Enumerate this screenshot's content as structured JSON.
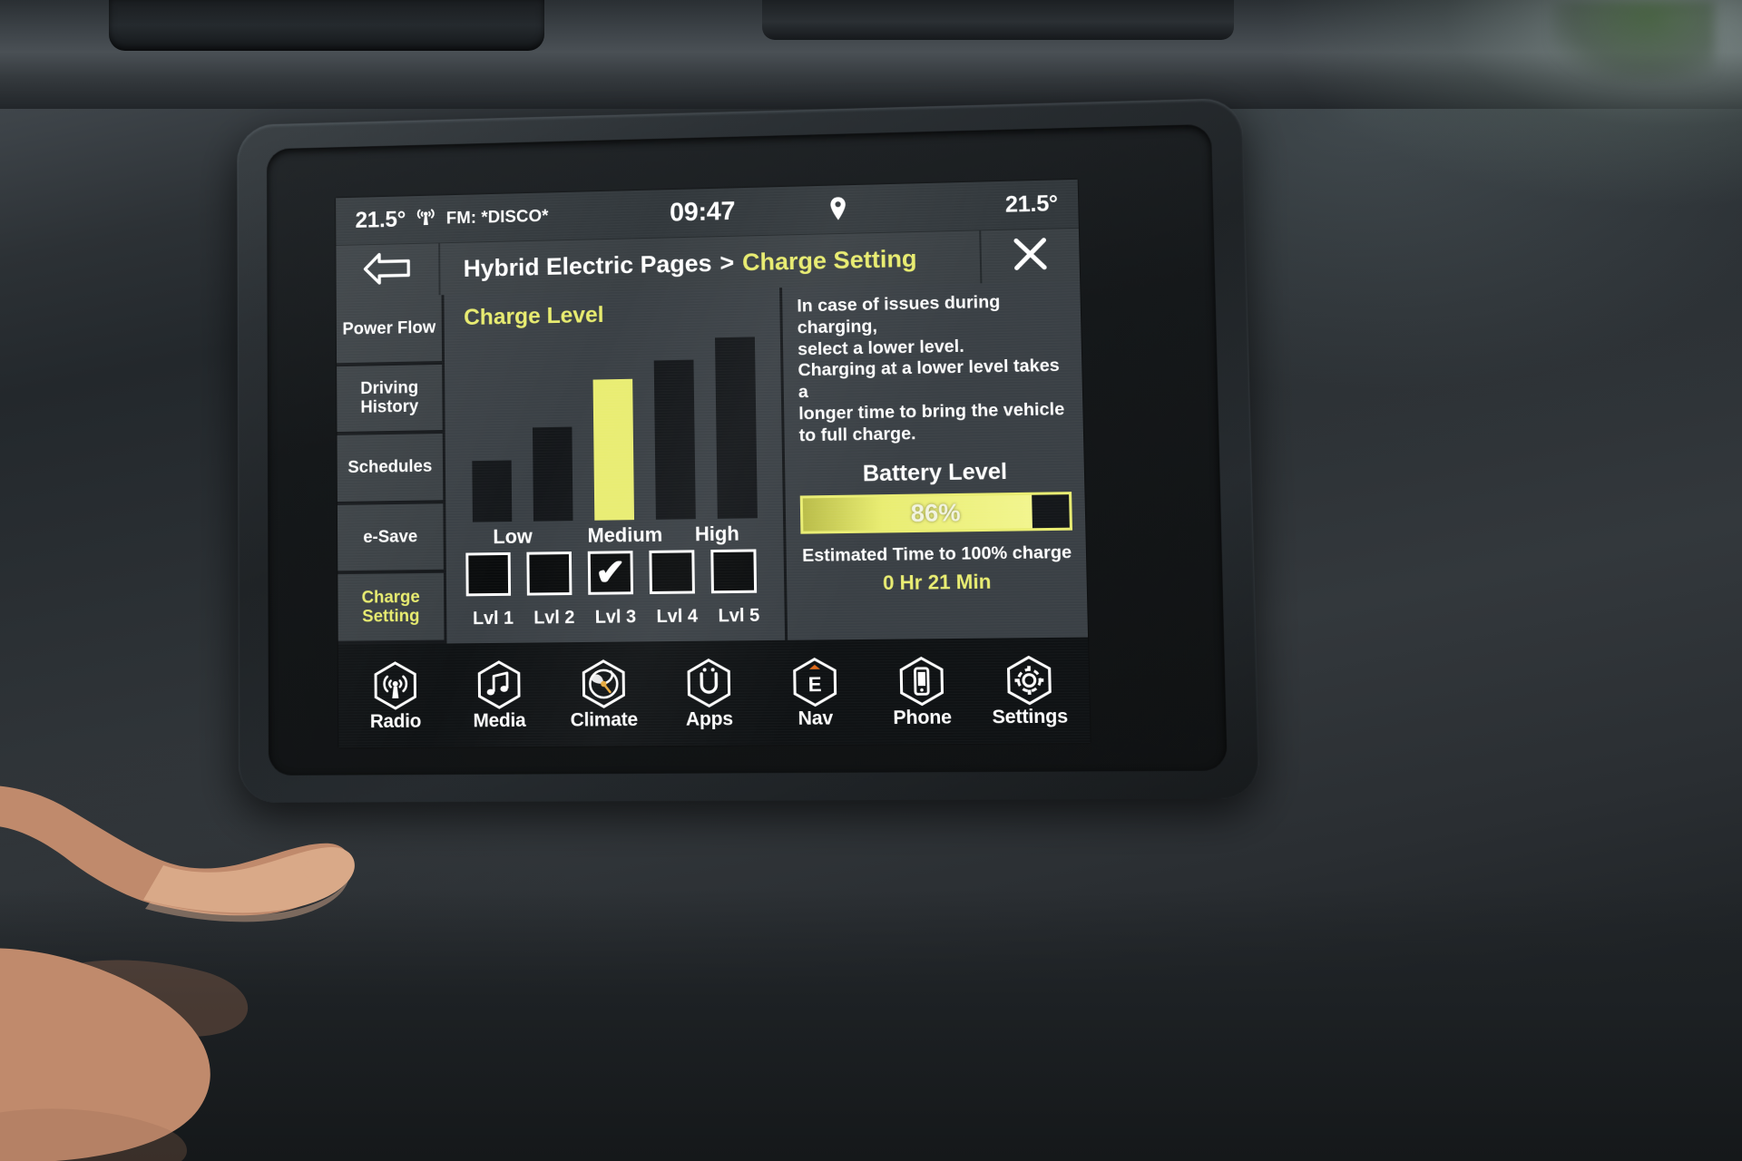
{
  "status_bar": {
    "temp_left": "21.5°",
    "radio_icon": "radio-waves-icon",
    "radio_label": "FM: *DISCO*",
    "clock": "09:47",
    "pin_icon": "location-pin-icon",
    "temp_right": "21.5°"
  },
  "header": {
    "back_icon": "back-arrow-icon",
    "breadcrumb_root": "Hybrid Electric Pages",
    "breadcrumb_separator": ">",
    "breadcrumb_current": "Charge Setting",
    "close_icon": "close-x-icon"
  },
  "sidebar": {
    "items": [
      {
        "label": "Power Flow",
        "active": false
      },
      {
        "label": "Driving History",
        "active": false
      },
      {
        "label": "Schedules",
        "active": false
      },
      {
        "label": "e-Save",
        "active": false
      },
      {
        "label": "Charge Setting",
        "active": true
      }
    ]
  },
  "chart_data": {
    "type": "bar",
    "title": "Charge Level",
    "categories": [
      "Lvl 1",
      "Lvl 2",
      "Lvl 3",
      "Lvl 4",
      "Lvl 5"
    ],
    "values": [
      34,
      52,
      78,
      88,
      100
    ],
    "zone_labels": [
      "Low",
      "Medium",
      "High"
    ],
    "selected_index": 2,
    "selected_color": "#e9ed72",
    "bar_color": "#14171a",
    "xlabel": "",
    "ylabel": "",
    "ylim": [
      0,
      100
    ],
    "grid": false,
    "legend": "none"
  },
  "charge_levels": {
    "checkbox_labels": [
      "Lvl 1",
      "Lvl 2",
      "Lvl 3",
      "Lvl 4",
      "Lvl 5"
    ],
    "checked": [
      false,
      false,
      true,
      false,
      false
    ],
    "check_glyph": "✔"
  },
  "info": {
    "notice_lines": [
      "In case of issues during charging,",
      "select a lower level.",
      "Charging at a lower level takes a",
      "longer time to bring the vehicle",
      "to full charge."
    ],
    "battery_title": "Battery Level",
    "battery_percent_label": "86%",
    "battery_percent_value": 86,
    "eta_label": "Estimated Time to 100% charge",
    "eta_value": "0 Hr 21 Min",
    "accent_color": "#e9ed72"
  },
  "dock": {
    "items": [
      {
        "label": "Radio",
        "icon": "radio-antenna-icon"
      },
      {
        "label": "Media",
        "icon": "music-note-icon"
      },
      {
        "label": "Climate",
        "icon": "fan-climate-icon"
      },
      {
        "label": "Apps",
        "icon": "apps-u-icon"
      },
      {
        "label": "Nav",
        "icon": "nav-e-icon"
      },
      {
        "label": "Phone",
        "icon": "phone-handset-icon"
      },
      {
        "label": "Settings",
        "icon": "gear-icon"
      }
    ]
  }
}
